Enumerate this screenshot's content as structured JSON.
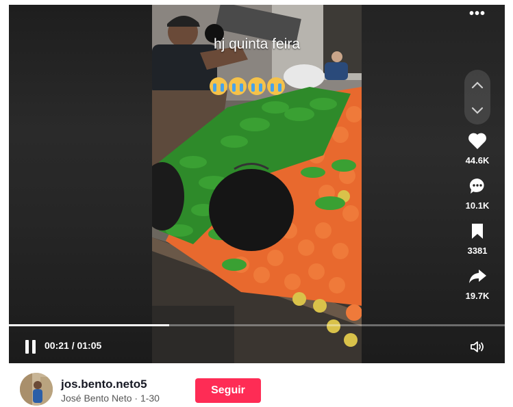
{
  "video": {
    "caption_overlay": "hj quinta feira",
    "emoji_count": 4,
    "progress": 0.323
  },
  "controls": {
    "time": "00:21 / 01:05"
  },
  "actions": {
    "likes": "44.6K",
    "comments": "10.1K",
    "saves": "3381",
    "shares": "19.7K"
  },
  "author": {
    "username": "jos.bento.neto5",
    "display_line": "José Bento Neto · 1-30",
    "follow_label": "Seguir"
  },
  "colors": {
    "follow_button": "#fe2c55"
  }
}
